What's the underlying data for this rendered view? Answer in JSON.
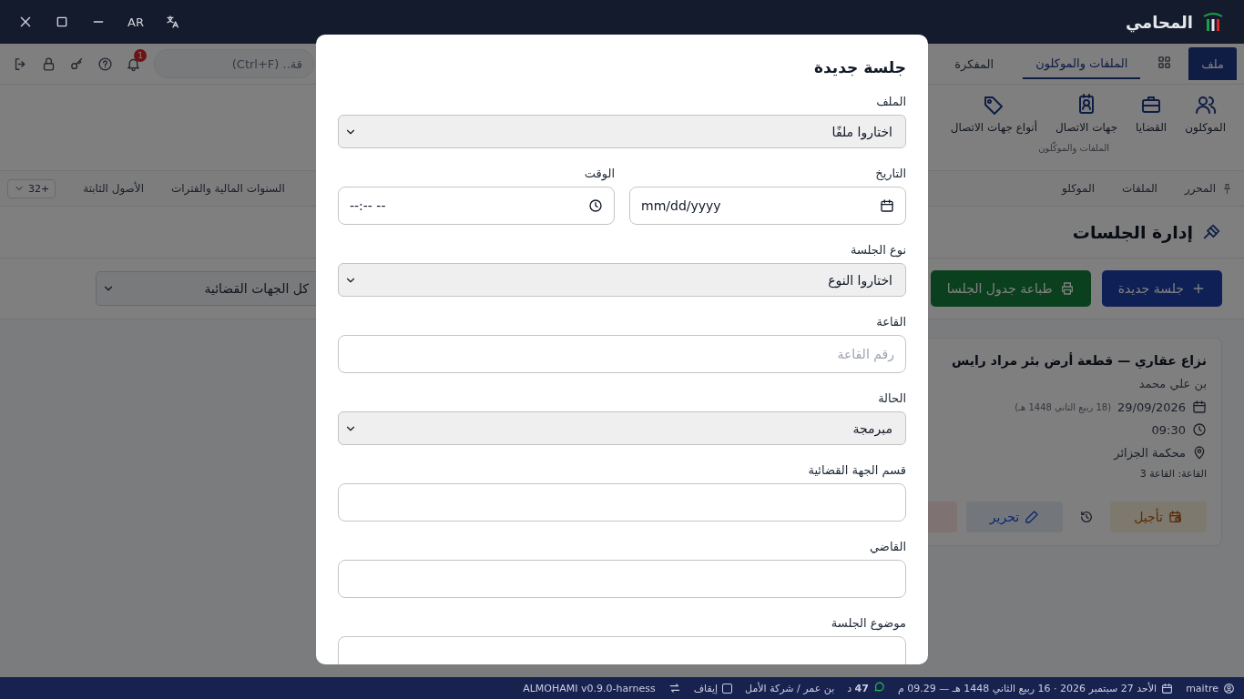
{
  "titlebar": {
    "app_name": "المحامي",
    "language": "AR"
  },
  "ribbon_tabs": [
    {
      "label": "ملف",
      "kind": "file",
      "selected": false
    },
    {
      "label": "الملفات والموكلون",
      "kind": "tab",
      "selected": true
    },
    {
      "label": "المفكرة",
      "kind": "tab",
      "selected": false
    }
  ],
  "search": {
    "placeholder": "قة.. (Ctrl+F)"
  },
  "notifications": {
    "badge": "1"
  },
  "ribbon_group": {
    "label": "الملفات والموكّلون",
    "items": [
      {
        "label": "الموكلون",
        "kind": "users"
      },
      {
        "label": "القضايا",
        "kind": "briefcase"
      },
      {
        "label": "جهات الاتصال",
        "kind": "contact"
      },
      {
        "label": "أنواع جهات الاتصال",
        "kind": "tag"
      }
    ]
  },
  "page_tabs": {
    "right": [
      {
        "label": "المحرر",
        "pinned": true
      },
      {
        "label": "الملفات",
        "pinned": false
      },
      {
        "label": "الموكلو",
        "pinned": false
      }
    ],
    "left": [
      {
        "label": "السنوات المالية والفترات"
      },
      {
        "label": "الأصول الثابتة"
      }
    ],
    "overflow": "32+"
  },
  "page": {
    "title": "إدارة الجلسات"
  },
  "toolbar": {
    "buttons": [
      {
        "label": "جلسة جديدة",
        "kind": "primary"
      },
      {
        "label": "طباعة جدول الجلسا",
        "kind": "print"
      }
    ],
    "filter": {
      "value": "كل الجهات القضائية"
    }
  },
  "session_card": {
    "title": "نزاع عقاري — قطعة أرض بئر مراد رايس",
    "client": "بن علي محمد",
    "date": "29/09/2026",
    "hijri": "(18 ربيع الثاني 1448 هـ)",
    "time": "09:30",
    "court": "محكمة الجزائر",
    "room": "القاعة: القاعة 3",
    "actions": [
      {
        "kind": "postpone",
        "label": "تأجيل"
      },
      {
        "kind": "history"
      },
      {
        "kind": "edit",
        "label": "تحرير"
      },
      {
        "kind": "delete"
      }
    ]
  },
  "modal": {
    "title": "جلسة جديدة",
    "rows": [
      [
        {
          "label": "الملف",
          "kind": "select",
          "value": "اختاروا ملفًا"
        }
      ],
      [
        {
          "label": "التاريخ",
          "kind": "date",
          "value": "mm/dd/yyyy"
        },
        {
          "label": "الوقت",
          "kind": "time",
          "value": "--:-- --"
        }
      ],
      [
        {
          "label": "نوع الجلسة",
          "kind": "select",
          "value": "اختاروا النوع"
        }
      ],
      [
        {
          "label": "القاعة",
          "kind": "text",
          "placeholder": "رقم القاعة"
        }
      ],
      [
        {
          "label": "الحالة",
          "kind": "select",
          "value": "مبرمجة"
        }
      ],
      [
        {
          "label": "قسم الجهة القضائية",
          "kind": "text"
        }
      ],
      [
        {
          "label": "القاضي",
          "kind": "text"
        }
      ],
      [
        {
          "label": "موضوع الجلسة",
          "kind": "text"
        }
      ]
    ]
  },
  "status_bar": {
    "user": "maitre",
    "datetime": "الأحد 27 سبتمبر 2026 · 16 ربيع الثاني 1448 هـ — 09.29 م",
    "timer": "**47** د",
    "company": "بن عمر / شركة الأمل",
    "pause": {
      "label": "إيقاف",
      "checked": false
    },
    "version": "ALMOHAMI v0.9.0-harness"
  }
}
